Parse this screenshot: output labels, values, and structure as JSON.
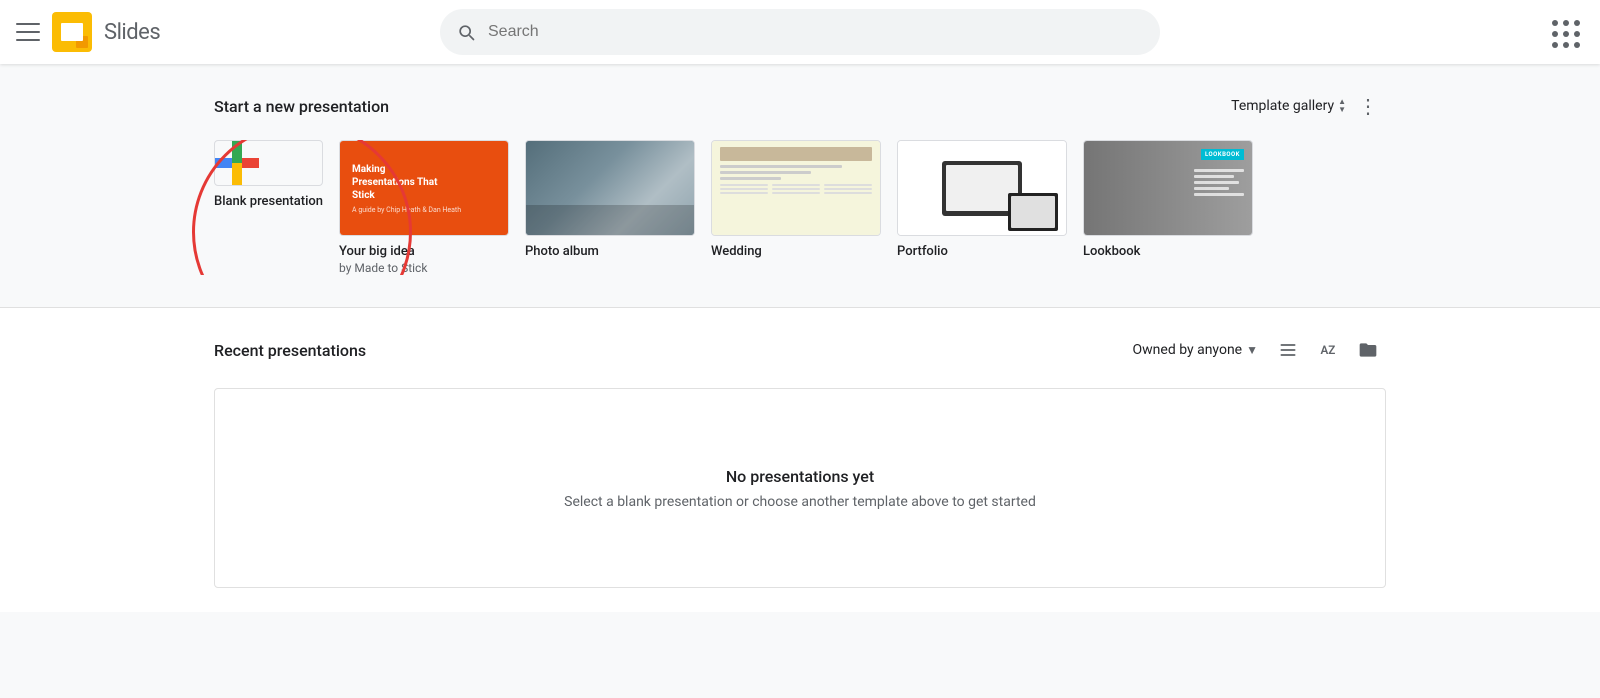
{
  "header": {
    "app_name": "Slides",
    "search_placeholder": "Search"
  },
  "template_section": {
    "title": "Start a new presentation",
    "gallery_label": "Template gallery",
    "templates": [
      {
        "id": "blank",
        "name": "Blank presentation",
        "sub": ""
      },
      {
        "id": "made-to-stick",
        "name": "Your big idea",
        "sub": "by Made to Stick",
        "title_line1": "Making",
        "title_line2": "Presentations That",
        "title_line3": "Stick",
        "subtitle": "A guide by Chip Heath & Dan Heath"
      },
      {
        "id": "photo-album",
        "name": "Photo album",
        "sub": ""
      },
      {
        "id": "wedding",
        "name": "Wedding",
        "sub": ""
      },
      {
        "id": "portfolio",
        "name": "Portfolio",
        "sub": ""
      },
      {
        "id": "lookbook",
        "name": "Lookbook",
        "sub": "",
        "tag": "LOOKBOOK"
      }
    ]
  },
  "recent_section": {
    "title": "Recent presentations",
    "owned_by_label": "Owned by anyone",
    "empty_title": "No presentations yet",
    "empty_sub": "Select a blank presentation or choose another template above to get started"
  }
}
